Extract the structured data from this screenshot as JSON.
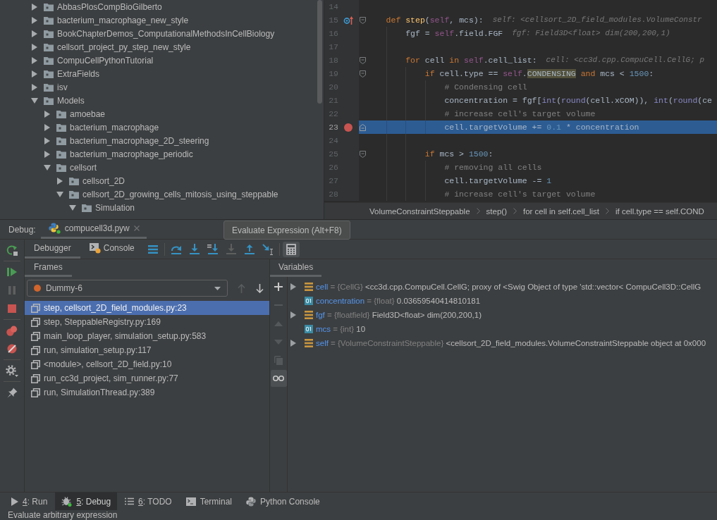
{
  "project_tree": {
    "items": [
      {
        "label": "AbbasPlosCompBioGilberto",
        "expanded": false
      },
      {
        "label": "bacterium_macrophage_new_style",
        "expanded": false
      },
      {
        "label": "BookChapterDemos_ComputationalMethodsInCellBiology",
        "expanded": false
      },
      {
        "label": "cellsort_project_py_step_new_style",
        "expanded": false
      },
      {
        "label": "CompuCellPythonTutorial",
        "expanded": false
      },
      {
        "label": "ExtraFields",
        "expanded": false
      },
      {
        "label": "isv",
        "expanded": false
      },
      {
        "label": "Models",
        "expanded": true,
        "children": [
          {
            "label": "amoebae",
            "expanded": false
          },
          {
            "label": "bacterium_macrophage",
            "expanded": false
          },
          {
            "label": "bacterium_macrophage_2D_steering",
            "expanded": false
          },
          {
            "label": "bacterium_macrophage_periodic",
            "expanded": false
          },
          {
            "label": "cellsort",
            "expanded": true,
            "children": [
              {
                "label": "cellsort_2D",
                "expanded": false
              },
              {
                "label": "cellsort_2D_growing_cells_mitosis_using_steppable",
                "expanded": true,
                "children": [
                  {
                    "label": "Simulation",
                    "expanded": true
                  }
                ]
              }
            ]
          }
        ]
      }
    ]
  },
  "editor": {
    "lines": [
      {
        "number": "14",
        "current": false
      },
      {
        "number": "15",
        "marker": {
          "kind": "override"
        },
        "fold": {
          "kind": "start"
        },
        "current": false,
        "tokens": [
          {
            "kind": "keyword",
            "text": "def "
          },
          {
            "kind": "func",
            "text": "step"
          },
          {
            "kind": "plain",
            "text": "("
          },
          {
            "kind": "self",
            "text": "self"
          },
          {
            "kind": "plain",
            "text": ", mcs):"
          }
        ],
        "hint": "self: <cellsort_2D_field_modules.VolumeConstr",
        "children": [
          {
            "number": "16",
            "current": false,
            "tokens": [
              {
                "kind": "plain",
                "text": "fgf = "
              },
              {
                "kind": "self",
                "text": "self"
              },
              {
                "kind": "plain",
                "text": ".field.FGF"
              }
            ],
            "hint": "fgf: Field3D<float> dim(200,200,1)"
          },
          {
            "number": "17",
            "current": false
          },
          {
            "number": "18",
            "fold": {
              "kind": "start"
            },
            "current": false,
            "tokens": [
              {
                "kind": "keyword",
                "text": "for"
              },
              {
                "kind": "plain",
                "text": " cell "
              },
              {
                "kind": "keyword",
                "text": "in "
              },
              {
                "kind": "self",
                "text": "self"
              },
              {
                "kind": "plain",
                "text": ".cell_list:"
              }
            ],
            "hint": "cell: <cc3d.cpp.CompuCell.CellG; p",
            "children": [
              {
                "number": "19",
                "fold": {
                  "kind": "start"
                },
                "current": false,
                "tokens": [
                  {
                    "kind": "keyword",
                    "text": "if"
                  },
                  {
                    "kind": "plain",
                    "text": " cell.type == "
                  },
                  {
                    "kind": "self",
                    "text": "self"
                  },
                  {
                    "kind": "plain",
                    "text": "."
                  },
                  {
                    "kind": "match",
                    "text": "CONDENSING"
                  },
                  {
                    "kind": "keyword",
                    "text": " and"
                  },
                  {
                    "kind": "plain",
                    "text": " mcs < "
                  },
                  {
                    "kind": "number",
                    "text": "1500"
                  },
                  {
                    "kind": "plain",
                    "text": ":"
                  }
                ],
                "children": [
                  {
                    "number": "20",
                    "current": false,
                    "tokens": [
                      {
                        "kind": "comment",
                        "text": "# Condensing cell"
                      }
                    ]
                  },
                  {
                    "number": "21",
                    "current": false,
                    "tokens": [
                      {
                        "kind": "plain",
                        "text": "concentration = fgf["
                      },
                      {
                        "kind": "builtin",
                        "text": "int"
                      },
                      {
                        "kind": "plain",
                        "text": "("
                      },
                      {
                        "kind": "builtin",
                        "text": "round"
                      },
                      {
                        "kind": "plain",
                        "text": "(cell.xCOM)), "
                      },
                      {
                        "kind": "builtin",
                        "text": "int"
                      },
                      {
                        "kind": "plain",
                        "text": "("
                      },
                      {
                        "kind": "builtin",
                        "text": "round"
                      },
                      {
                        "kind": "plain",
                        "text": "(ce"
                      }
                    ]
                  },
                  {
                    "number": "22",
                    "current": false,
                    "tokens": [
                      {
                        "kind": "comment",
                        "text": "# increase cell's target volume"
                      }
                    ]
                  },
                  {
                    "number": "23",
                    "marker": {
                      "kind": "breakpoint"
                    },
                    "fold": {
                      "kind": "end"
                    },
                    "current": true,
                    "tokens": [
                      {
                        "kind": "plain",
                        "text": "cell.targetVolume += "
                      },
                      {
                        "kind": "number",
                        "text": "0.1"
                      },
                      {
                        "kind": "plain",
                        "text": " * concentration"
                      }
                    ]
                  }
                ]
              },
              {
                "number": "24",
                "current": false
              },
              {
                "number": "25",
                "fold": {
                  "kind": "start"
                },
                "current": false,
                "tokens": [
                  {
                    "kind": "keyword",
                    "text": "if"
                  },
                  {
                    "kind": "plain",
                    "text": " mcs > "
                  },
                  {
                    "kind": "number",
                    "text": "1500"
                  },
                  {
                    "kind": "plain",
                    "text": ":"
                  }
                ],
                "children": [
                  {
                    "number": "26",
                    "current": false,
                    "tokens": [
                      {
                        "kind": "comment",
                        "text": "# removing all cells"
                      }
                    ]
                  },
                  {
                    "number": "27",
                    "current": false,
                    "tokens": [
                      {
                        "kind": "plain",
                        "text": "cell.targetVolume -= "
                      },
                      {
                        "kind": "number",
                        "text": "1"
                      }
                    ]
                  },
                  {
                    "number": "28",
                    "current": false,
                    "tokens": [
                      {
                        "kind": "comment",
                        "text": "# increase cell's target volume"
                      }
                    ]
                  }
                ]
              }
            ]
          }
        ]
      }
    ],
    "breadcrumbs": [
      "VolumeConstraintSteppable",
      "step()",
      "for cell in self.cell_list",
      "if cell.type == self.COND"
    ]
  },
  "debug": {
    "label": "Debug:",
    "sessions": [
      {
        "label": "compucell3d.pyw",
        "selected": true
      }
    ],
    "side_toolbar": [
      [
        {
          "kind": "rerun",
          "disabled": false
        }
      ],
      [
        {
          "kind": "resume",
          "disabled": false
        },
        {
          "kind": "pause",
          "disabled": true
        },
        {
          "kind": "stop",
          "disabled": false
        }
      ],
      [
        {
          "kind": "view_breakpoints",
          "disabled": false
        },
        {
          "kind": "mute_breakpoints",
          "disabled": false
        }
      ],
      [
        {
          "kind": "settings",
          "disabled": false
        }
      ],
      [
        {
          "kind": "pin",
          "disabled": false
        }
      ]
    ],
    "tabs": [
      {
        "label": "Debugger",
        "kind": "debugger",
        "selected": true
      },
      {
        "label": "Console",
        "kind": "console",
        "selected": false
      }
    ],
    "toolbar": [
      [
        {
          "kind": "threads",
          "disabled": false,
          "hovered": false
        }
      ],
      [
        {
          "kind": "step_over",
          "disabled": false,
          "hovered": false
        },
        {
          "kind": "step_into",
          "disabled": false,
          "hovered": false
        },
        {
          "kind": "step_into_my_code",
          "disabled": false,
          "hovered": false
        },
        {
          "kind": "force_step_into",
          "disabled": true,
          "hovered": false
        },
        {
          "kind": "step_out",
          "disabled": false,
          "hovered": false
        },
        {
          "kind": "run_to_cursor",
          "disabled": false,
          "hovered": false
        }
      ],
      [
        {
          "kind": "evaluate",
          "disabled": false,
          "hovered": true
        }
      ]
    ],
    "tooltip": "Evaluate Expression (Alt+F8)"
  },
  "frames": {
    "title": "Frames",
    "thread": "Dummy-6",
    "nav": [
      {
        "kind": "up",
        "disabled": true
      },
      {
        "kind": "down",
        "disabled": false
      }
    ],
    "items": [
      {
        "label": "step, cellsort_2D_field_modules.py:23",
        "selected": true
      },
      {
        "label": "step, SteppableRegistry.py:169",
        "selected": false
      },
      {
        "label": "main_loop_player, simulation_setup.py:583",
        "selected": false
      },
      {
        "label": "run, simulation_setup.py:117",
        "selected": false
      },
      {
        "label": "<module>, cellsort_2D_field.py:10",
        "selected": false
      },
      {
        "label": "run_cc3d_project, sim_runner.py:77",
        "selected": false
      },
      {
        "label": "run, SimulationThread.py:389",
        "selected": false
      }
    ]
  },
  "variables": {
    "title": "Variables",
    "toolbar": [
      {
        "kind": "add",
        "disabled": false,
        "on": false
      },
      {
        "kind": "remove",
        "disabled": true,
        "on": false
      },
      {
        "kind": "move_up",
        "disabled": true,
        "on": false
      },
      {
        "kind": "move_down",
        "disabled": true,
        "on": false
      },
      {
        "kind": "copy",
        "disabled": true,
        "on": false
      },
      {
        "kind": "inline_values",
        "disabled": false,
        "on": true
      }
    ],
    "items": [
      {
        "kind": "object",
        "expanded": false,
        "name": "cell",
        "sep": "=",
        "type": "{CellG}",
        "value": "<cc3d.cpp.CompuCell.CellG; proxy of <Swig Object of type 'std::vector< CompuCell3D::CellG"
      },
      {
        "kind": "number",
        "name": "concentration",
        "sep": "=",
        "type": "{float}",
        "value": "0.03659540414810181"
      },
      {
        "kind": "object",
        "expanded": false,
        "name": "fgf",
        "sep": "=",
        "type": "{floatfield}",
        "value": "Field3D<float> dim(200,200,1)"
      },
      {
        "kind": "number",
        "name": "mcs",
        "sep": "=",
        "type": "{int}",
        "value": "10"
      },
      {
        "kind": "object",
        "expanded": false,
        "name": "self",
        "sep": "=",
        "type": "{VolumeConstraintSteppable}",
        "value": "<cellsort_2D_field_modules.VolumeConstraintSteppable object at 0x000"
      }
    ]
  },
  "tool_windows": [
    {
      "kind": "run",
      "mnemonic": "4",
      "label": ": Run",
      "selected": false
    },
    {
      "kind": "debug",
      "mnemonic": "5",
      "label": ": Debug",
      "selected": true
    },
    {
      "kind": "todo",
      "mnemonic": "6",
      "label": ": TODO",
      "selected": false
    },
    {
      "kind": "terminal",
      "label": "Terminal",
      "selected": false
    },
    {
      "kind": "python_console",
      "label": "Python Console",
      "selected": false
    }
  ],
  "status_bar": {
    "text": "Evaluate arbitrary expression"
  }
}
